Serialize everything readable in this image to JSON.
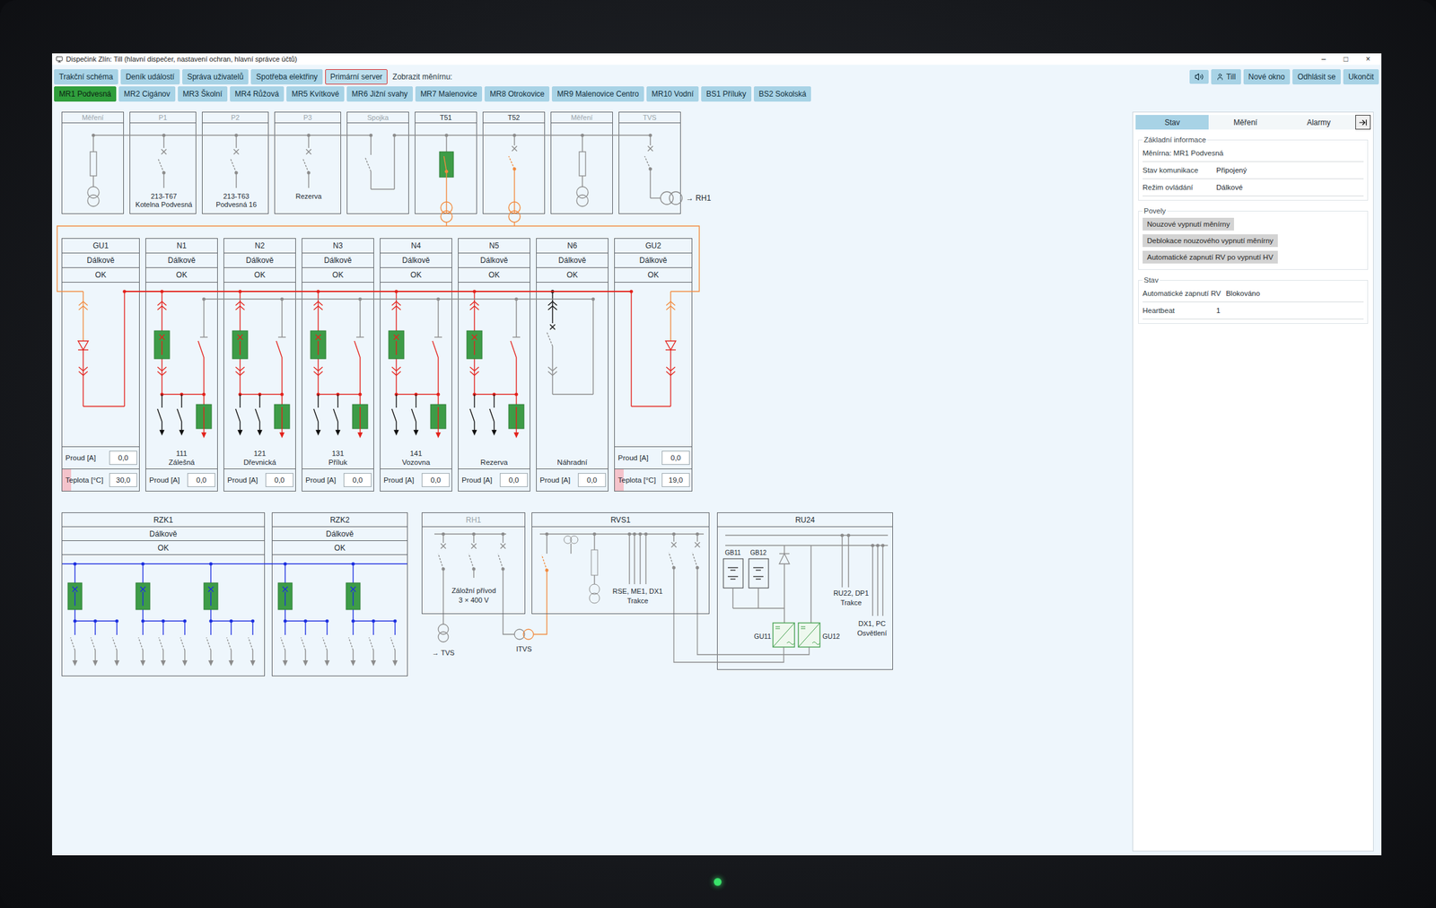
{
  "window": {
    "title": "Dispečink Zlín: Till (hlavní dispečer, nastavení ochran, hlavní správce účtů)",
    "controls": [
      "–",
      "□",
      "×"
    ]
  },
  "toolbar": {
    "buttons": [
      {
        "label": "Trakční schéma",
        "highlighted": false
      },
      {
        "label": "Deník událostí",
        "highlighted": false
      },
      {
        "label": "Správa uživatelů",
        "highlighted": false
      },
      {
        "label": "Spotřeba elektřiny",
        "highlighted": false
      },
      {
        "label": "Primární server",
        "highlighted": true
      }
    ],
    "station_prompt": "Zobrazit měnírnu:",
    "actions": [
      {
        "kind": "sound"
      },
      {
        "kind": "user",
        "label": "Till"
      },
      {
        "kind": "text",
        "label": "Nové okno"
      },
      {
        "kind": "text",
        "label": "Odhlásit se"
      },
      {
        "kind": "text",
        "label": "Ukončit"
      }
    ]
  },
  "stations": [
    {
      "label": "MR1 Podvesná",
      "selected": true
    },
    {
      "label": "MR2 Cigánov",
      "selected": false
    },
    {
      "label": "MR3 Školní",
      "selected": false
    },
    {
      "label": "MR4 Růžová",
      "selected": false
    },
    {
      "label": "MR5 Kvítkové",
      "selected": false
    },
    {
      "label": "MR6 Jižní svahy",
      "selected": false
    },
    {
      "label": "MR7 Malenovice",
      "selected": false
    },
    {
      "label": "MR8 Otrokovice",
      "selected": false
    },
    {
      "label": "MR9 Malenovice Centro",
      "selected": false
    },
    {
      "label": "MR10 Vodní",
      "selected": false
    },
    {
      "label": "BS1 Příluky",
      "selected": false
    },
    {
      "label": "BS2 Sokolská",
      "selected": false
    }
  ],
  "diagram": {
    "top_cells": [
      {
        "name": "Měření",
        "kind": "meter",
        "active": false,
        "energized": false,
        "captions": []
      },
      {
        "name": "P1",
        "kind": "feeder",
        "active": false,
        "energized": false,
        "closed": false,
        "captions": [
          "213-T67",
          "Kotelna Podvesná"
        ]
      },
      {
        "name": "P2",
        "kind": "feeder",
        "active": false,
        "energized": false,
        "closed": false,
        "captions": [
          "213-T63",
          "Podvesná 16"
        ]
      },
      {
        "name": "P3",
        "kind": "feeder",
        "active": false,
        "energized": false,
        "closed": false,
        "captions": [
          "Rezerva"
        ]
      },
      {
        "name": "Spojka",
        "kind": "coupler",
        "active": false,
        "energized": false,
        "closed": false,
        "captions": []
      },
      {
        "name": "T51",
        "kind": "transformer",
        "active": true,
        "energized": true,
        "closed": true,
        "captions": []
      },
      {
        "name": "T52",
        "kind": "transformer",
        "active": true,
        "energized": true,
        "closed": false,
        "captions": []
      },
      {
        "name": "Měření",
        "kind": "meter",
        "active": false,
        "energized": false,
        "captions": []
      },
      {
        "name": "TVS",
        "kind": "tvs",
        "active": false,
        "energized": false,
        "closed": false,
        "captions": []
      }
    ],
    "tvs_link": "→ RH1",
    "middle_cells": [
      {
        "name": "GU1",
        "mode": "Dálkově",
        "status": "OK",
        "kind": "rectifier",
        "energized": true,
        "captions": [],
        "fields": [
          {
            "label": "Proud [A]",
            "value": "0,0",
            "alarm": false
          },
          {
            "label": "Teplota [°C]",
            "value": "30,0",
            "alarm": true
          }
        ]
      },
      {
        "name": "N1",
        "mode": "Dálkově",
        "status": "OK",
        "kind": "feeder",
        "energized": true,
        "closed": true,
        "captions": [
          "111",
          "Zálešná"
        ],
        "fields": [
          {
            "label": "Proud [A]",
            "value": "0,0",
            "alarm": false
          }
        ]
      },
      {
        "name": "N2",
        "mode": "Dálkově",
        "status": "OK",
        "kind": "feeder",
        "energized": true,
        "closed": true,
        "captions": [
          "121",
          "Dřevnická"
        ],
        "fields": [
          {
            "label": "Proud [A]",
            "value": "0,0",
            "alarm": false
          }
        ]
      },
      {
        "name": "N3",
        "mode": "Dálkově",
        "status": "OK",
        "kind": "feeder",
        "energized": true,
        "closed": true,
        "captions": [
          "131",
          "Příluk"
        ],
        "fields": [
          {
            "label": "Proud [A]",
            "value": "0,0",
            "alarm": false
          }
        ]
      },
      {
        "name": "N4",
        "mode": "Dálkově",
        "status": "OK",
        "kind": "feeder",
        "energized": true,
        "closed": true,
        "captions": [
          "141",
          "Vozovna"
        ],
        "fields": [
          {
            "label": "Proud [A]",
            "value": "0,0",
            "alarm": false
          }
        ]
      },
      {
        "name": "N5",
        "mode": "Dálkově",
        "status": "OK",
        "kind": "feeder",
        "energized": true,
        "closed": true,
        "captions": [
          "Rezerva"
        ],
        "fields": [
          {
            "label": "Proud [A]",
            "value": "0,0",
            "alarm": false
          }
        ]
      },
      {
        "name": "N6",
        "mode": "Dálkově",
        "status": "OK",
        "kind": "spare",
        "energized": false,
        "closed": false,
        "captions": [
          "Náhradní"
        ],
        "fields": [
          {
            "label": "Proud [A]",
            "value": "0,0",
            "alarm": false
          }
        ]
      },
      {
        "name": "GU2",
        "mode": "Dálkově",
        "status": "OK",
        "kind": "rectifier",
        "energized": true,
        "captions": [],
        "fields": [
          {
            "label": "Proud [A]",
            "value": "0,0",
            "alarm": false
          },
          {
            "label": "Teplota [°C]",
            "value": "19,0",
            "alarm": true
          }
        ]
      }
    ],
    "bottom_cells": [
      {
        "name": "RZK1",
        "kind": "distribution",
        "mode": "Dálkově",
        "status": "OK",
        "breakers": [
          true,
          true,
          true
        ]
      },
      {
        "name": "RZK2",
        "kind": "distribution",
        "mode": "Dálkově",
        "status": "OK",
        "breakers": [
          true,
          true
        ]
      },
      {
        "name": "RH1",
        "kind": "backup",
        "active": false,
        "labels": [
          "Záložní přívod",
          "3 × 400 V"
        ]
      },
      {
        "name": "RVS1",
        "kind": "auxiliary",
        "active": true,
        "labels": [
          "RSE, ME1, DX1",
          "Trakce"
        ]
      },
      {
        "name": "RU24",
        "kind": "dc",
        "active": true,
        "batteries": [
          "GB11",
          "GB12"
        ],
        "converters": [
          "GU11",
          "GU12"
        ],
        "outputs": [
          [
            "RU22, DP1",
            "Trakce"
          ],
          [
            "DX1, PC",
            "Osvětlení"
          ]
        ]
      }
    ],
    "external": {
      "tvs": "→ TVS",
      "itvs": "ITVS"
    }
  },
  "side_panel": {
    "tabs": [
      {
        "label": "Stav",
        "selected": true
      },
      {
        "label": "Měření",
        "selected": false
      },
      {
        "label": "Alarmy",
        "selected": false
      }
    ],
    "info": {
      "title": "Základní informace",
      "rows": [
        {
          "label": "Měnírna: MR1 Podvesná"
        },
        {
          "label": "Stav komunikace",
          "value": "Připojený"
        },
        {
          "label": "Režim ovládání",
          "value": "Dálkové"
        }
      ]
    },
    "commands": {
      "title": "Povely",
      "buttons": [
        "Nouzové vypnutí měnírny",
        "Deblokace nouzového vypnutí měnírny",
        "Automatické zapnutí RV po vypnutí HV"
      ]
    },
    "state": {
      "title": "Stav",
      "rows": [
        {
          "label": "Automatické zapnutí RV",
          "value": "Blokováno"
        },
        {
          "label": "Heartbeat",
          "value": "1"
        }
      ]
    }
  }
}
